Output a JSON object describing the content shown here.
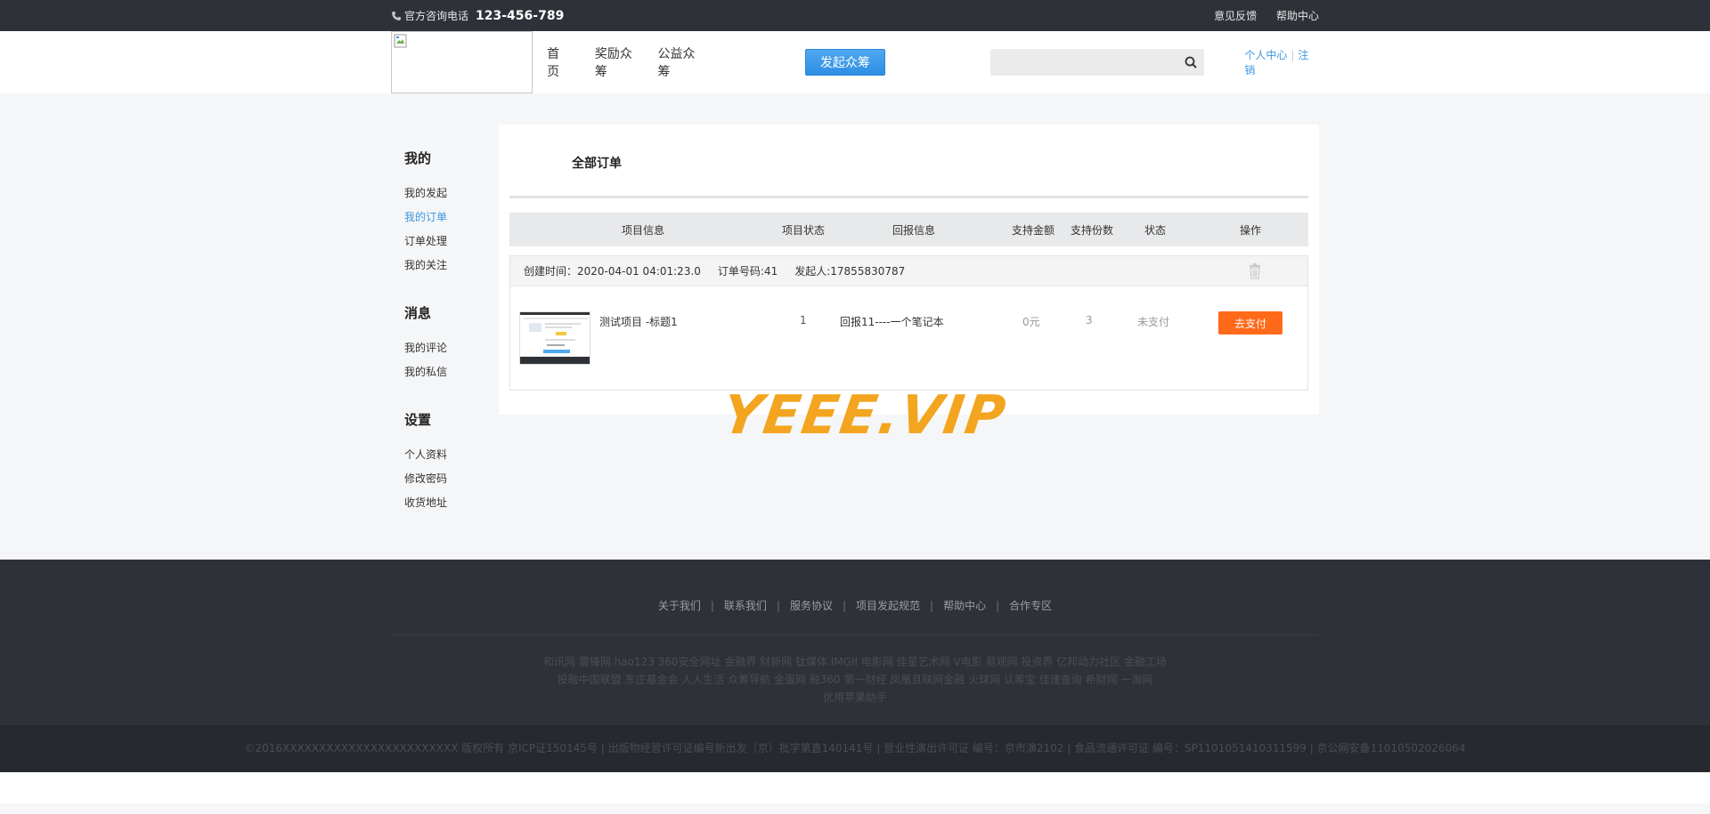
{
  "topbar": {
    "phone_label": "官方咨询电话",
    "phone_number": "123-456-789",
    "feedback": "意见反馈",
    "help": "帮助中心"
  },
  "header": {
    "nav": [
      "首页",
      "奖励众筹",
      "公益众筹"
    ],
    "start_button": "发起众筹",
    "search_placeholder": "",
    "user_center": "个人中心",
    "logout": "注销"
  },
  "sidebar": {
    "groups": [
      {
        "title": "我的",
        "items": [
          "我的发起",
          "我的订单",
          "订单处理",
          "我的关注"
        ]
      },
      {
        "title": "消息",
        "items": [
          "我的评论",
          "我的私信"
        ]
      },
      {
        "title": "设置",
        "items": [
          "个人资料",
          "修改密码",
          "收货地址"
        ]
      }
    ],
    "active_item": "我的订单"
  },
  "content": {
    "title": "全部订单",
    "columns": [
      "项目信息",
      "项目状态",
      "回报信息",
      "支持金额",
      "支持份数",
      "状态",
      "操作"
    ],
    "orders": [
      {
        "created": "创建时间：2020-04-01 04:01:23.0",
        "order_no": "订单号码:41",
        "initiator": "发起人:17855830787",
        "project": "测试项目 -标题1",
        "project_status": "1",
        "reward": "回报11----一个笔记本",
        "amount": "0元",
        "quantity": "3",
        "status": "未支付",
        "action": "去支付"
      }
    ]
  },
  "watermark": "YEEE.VIP",
  "footer": {
    "links": [
      "关于我们",
      "联系我们",
      "服务协议",
      "项目发起规范",
      "帮助中心",
      "合作专区"
    ],
    "friends_line1": "和讯网 雷锋网 hao123 360安全网址 金融界 财新网 钛媒体 IMGII 电影网 佳星艺术网 V电影 易观网 投资界 亿邦动力社区 金融工场",
    "friends_line2": "投融中国联盟 东庄基金会 人人生活 众筹导航 金蛋网 融360 第一财经 凤凰且联网金融 火球网 认筹宝 佳速查询 希财网 一淘网",
    "friends_line3": "优用苹果助手",
    "copyright": "©2016XXXXXXXXXXXXXXXXXXXXXXXX 版权所有 京ICP证150145号 | 出版物经营许可证编号新出发（京）批字第直140141号 | 营业性演出许可证 编号：京市演2102 | 食品流通许可证 编号：SP1101051410311599 | 京公网安备11010502026064"
  },
  "colors": {
    "accent_blue": "#3b97e3",
    "pay_orange": "#ff6a1a",
    "topbar_bg": "#2e3238",
    "watermark": "#f3a51f"
  }
}
